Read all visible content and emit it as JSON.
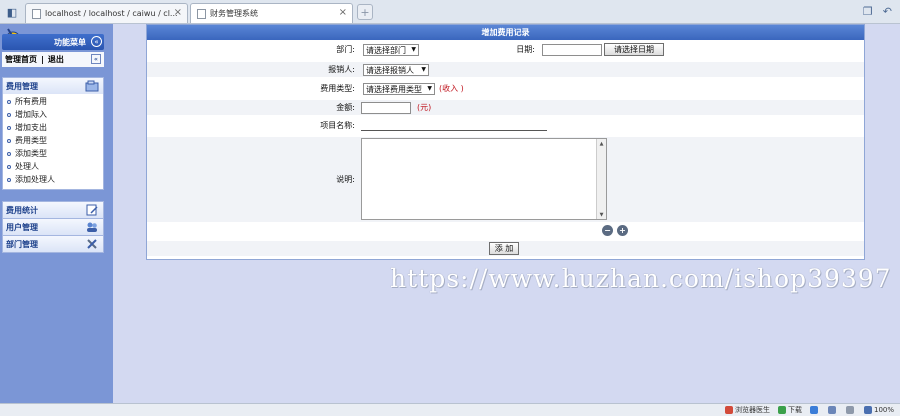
{
  "browser": {
    "tabs": [
      {
        "title": "localhost / localhost / caiwu / cl..."
      },
      {
        "title": "财务管理系统"
      }
    ]
  },
  "sidebar": {
    "menu_title": "功能菜单",
    "nav_home": "管理首页",
    "nav_sep": "|",
    "nav_logout": "退出",
    "groups": [
      {
        "title": "费用管理",
        "items": [
          {
            "label": "所有费用"
          },
          {
            "label": "增加际入"
          },
          {
            "label": "增加支出"
          },
          {
            "label": "费用类型"
          },
          {
            "label": "添加类型"
          },
          {
            "label": "处理人"
          },
          {
            "label": "添加处理人"
          }
        ]
      },
      {
        "title": "费用统计"
      },
      {
        "title": "用户管理"
      },
      {
        "title": "部门管理"
      }
    ]
  },
  "form": {
    "title": "增加费用记录",
    "dept_label": "部门:",
    "dept_value": "请选择部门",
    "date_label": "日期:",
    "date_button": "请选择日期",
    "reporter_label": "报销人:",
    "reporter_value": "请选择报销人",
    "type_label": "费用类型:",
    "type_value": "请选择费用类型",
    "type_note": "(收入 )",
    "amount_label": "金额:",
    "amount_unit": "(元)",
    "project_label": "项目名称:",
    "desc_label": "说明:",
    "submit": "添 加"
  },
  "watermark": "https://www.huzhan.com/ishop39397",
  "statusbar": {
    "items": [
      "浏览器医生",
      "下载",
      "100%"
    ]
  },
  "colors": {
    "background": "#d3d9f1",
    "sidebar": "#7b96d6",
    "form_title_bar": "#3a66bd",
    "note_red": "#c0151e"
  }
}
